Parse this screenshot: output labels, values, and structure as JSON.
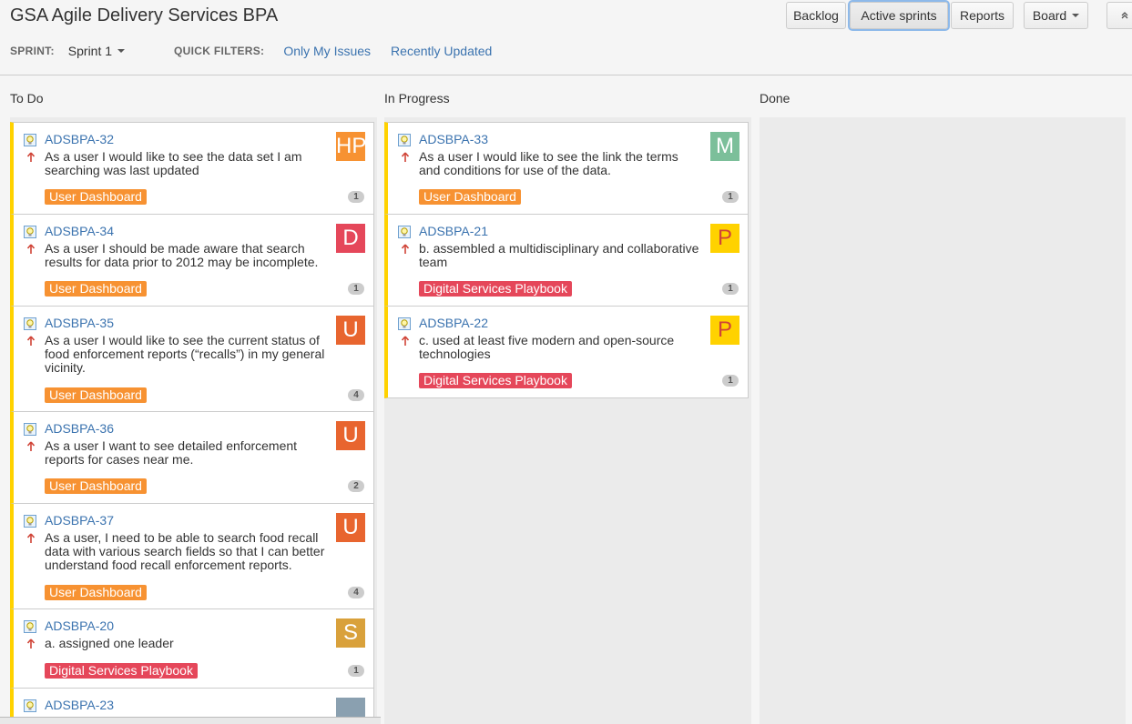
{
  "header": {
    "title": "GSA Agile Delivery Services BPA",
    "buttons": {
      "backlog": "Backlog",
      "active_sprints": "Active sprints",
      "reports": "Reports",
      "board": "Board"
    }
  },
  "subbar": {
    "sprint_label": "SPRINT:",
    "sprint_value": "Sprint 1",
    "quick_filters_label": "QUICK FILTERS:",
    "filters": [
      "Only My Issues",
      "Recently Updated"
    ]
  },
  "columns": [
    {
      "name": "To Do"
    },
    {
      "name": "In Progress"
    },
    {
      "name": "Done"
    }
  ],
  "cards": {
    "todo": [
      {
        "key": "ADSBPA-32",
        "summary": "As a user I would like to see the data set I am searching was last updated",
        "epic": "User Dashboard",
        "count": "1",
        "avatar": "HP",
        "avatar_color": "#f79232"
      },
      {
        "key": "ADSBPA-34",
        "summary": "As a user I should be made aware that search results for data prior to 2012 may be incomplete.",
        "epic": "User Dashboard",
        "count": "1",
        "avatar": "D",
        "avatar_color": "#e5475a"
      },
      {
        "key": "ADSBPA-35",
        "summary": "As a user I would like to see the current status of food enforcement reports (“recalls”) in my general vicinity.",
        "epic": "User Dashboard",
        "count": "4",
        "avatar": "U",
        "avatar_color": "#e8652f"
      },
      {
        "key": "ADSBPA-36",
        "summary": "As a user I want to see detailed enforcement reports for cases near me.",
        "epic": "User Dashboard",
        "count": "2",
        "avatar": "U",
        "avatar_color": "#e8652f"
      },
      {
        "key": "ADSBPA-37",
        "summary": "As a user, I need to be able to search food recall data with various search fields so that I can better understand food recall enforcement reports.",
        "epic": "User Dashboard",
        "count": "4",
        "avatar": "U",
        "avatar_color": "#e8652f"
      },
      {
        "key": "ADSBPA-20",
        "summary": "a. assigned one leader",
        "epic": "Digital Services Playbook",
        "count": "1",
        "avatar": "S",
        "avatar_color": "#d9a13b"
      },
      {
        "key": "ADSBPA-23",
        "summary": "",
        "epic": "",
        "count": "",
        "avatar": "",
        "avatar_color": "#8aa0b0"
      }
    ],
    "inprogress": [
      {
        "key": "ADSBPA-33",
        "summary": "As a user I would like to see the link the terms and conditions for use of the data.",
        "epic": "User Dashboard",
        "count": "1",
        "avatar": "M",
        "avatar_color": "#7cbf9a"
      },
      {
        "key": "ADSBPA-21",
        "summary": "b. assembled a multidisciplinary and collaborative team",
        "epic": "Digital Services Playbook",
        "count": "1",
        "avatar": "P",
        "avatar_color": "#ffd200"
      },
      {
        "key": "ADSBPA-22",
        "summary": "c. used at least five modern and open-source technologies",
        "epic": "Digital Services Playbook",
        "count": "1",
        "avatar": "P",
        "avatar_color": "#ffd200"
      }
    ]
  },
  "icons": {
    "story": "story-icon",
    "priority": "priority-up-icon"
  },
  "colors": {
    "card_border": "#ffd200",
    "link": "#3b73af",
    "epic_orange": "#f79232",
    "epic_pink": "#e5475a"
  }
}
